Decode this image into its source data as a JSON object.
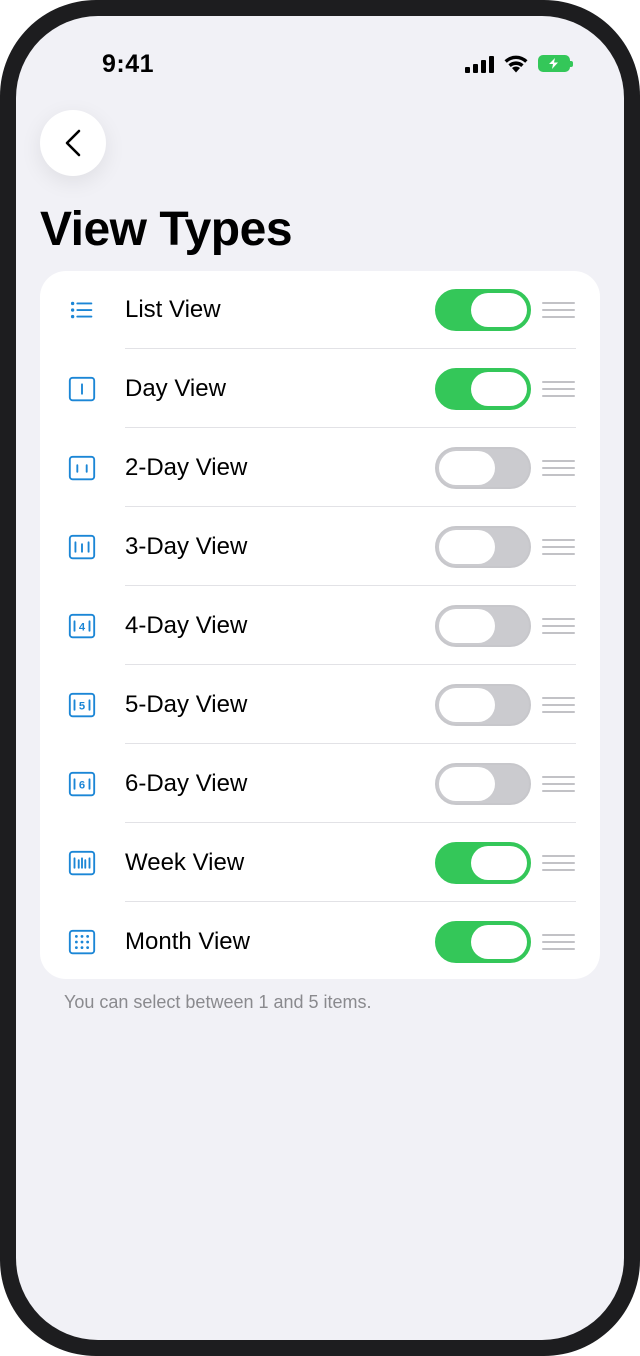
{
  "status_bar": {
    "time": "9:41"
  },
  "page": {
    "title": "View Types"
  },
  "items": [
    {
      "label": "List View",
      "icon": "list-icon",
      "enabled": true
    },
    {
      "label": "Day View",
      "icon": "day-view-icon",
      "enabled": true
    },
    {
      "label": "2-Day View",
      "icon": "2-day-view-icon",
      "enabled": false
    },
    {
      "label": "3-Day View",
      "icon": "3-day-view-icon",
      "enabled": false
    },
    {
      "label": "4-Day View",
      "icon": "4-day-view-icon",
      "enabled": false
    },
    {
      "label": "5-Day View",
      "icon": "5-day-view-icon",
      "enabled": false
    },
    {
      "label": "6-Day View",
      "icon": "6-day-view-icon",
      "enabled": false
    },
    {
      "label": "Week View",
      "icon": "week-view-icon",
      "enabled": true
    },
    {
      "label": "Month View",
      "icon": "month-view-icon",
      "enabled": true
    }
  ],
  "icon_glyphs": {
    "4": "4",
    "5": "5",
    "6": "6"
  },
  "footnote": "You can select between 1 and 5 items.",
  "colors": {
    "accent": "#1b86d6",
    "toggle_on": "#34c759",
    "toggle_off": "#cbcbcf",
    "background": "#f1f1f6"
  }
}
